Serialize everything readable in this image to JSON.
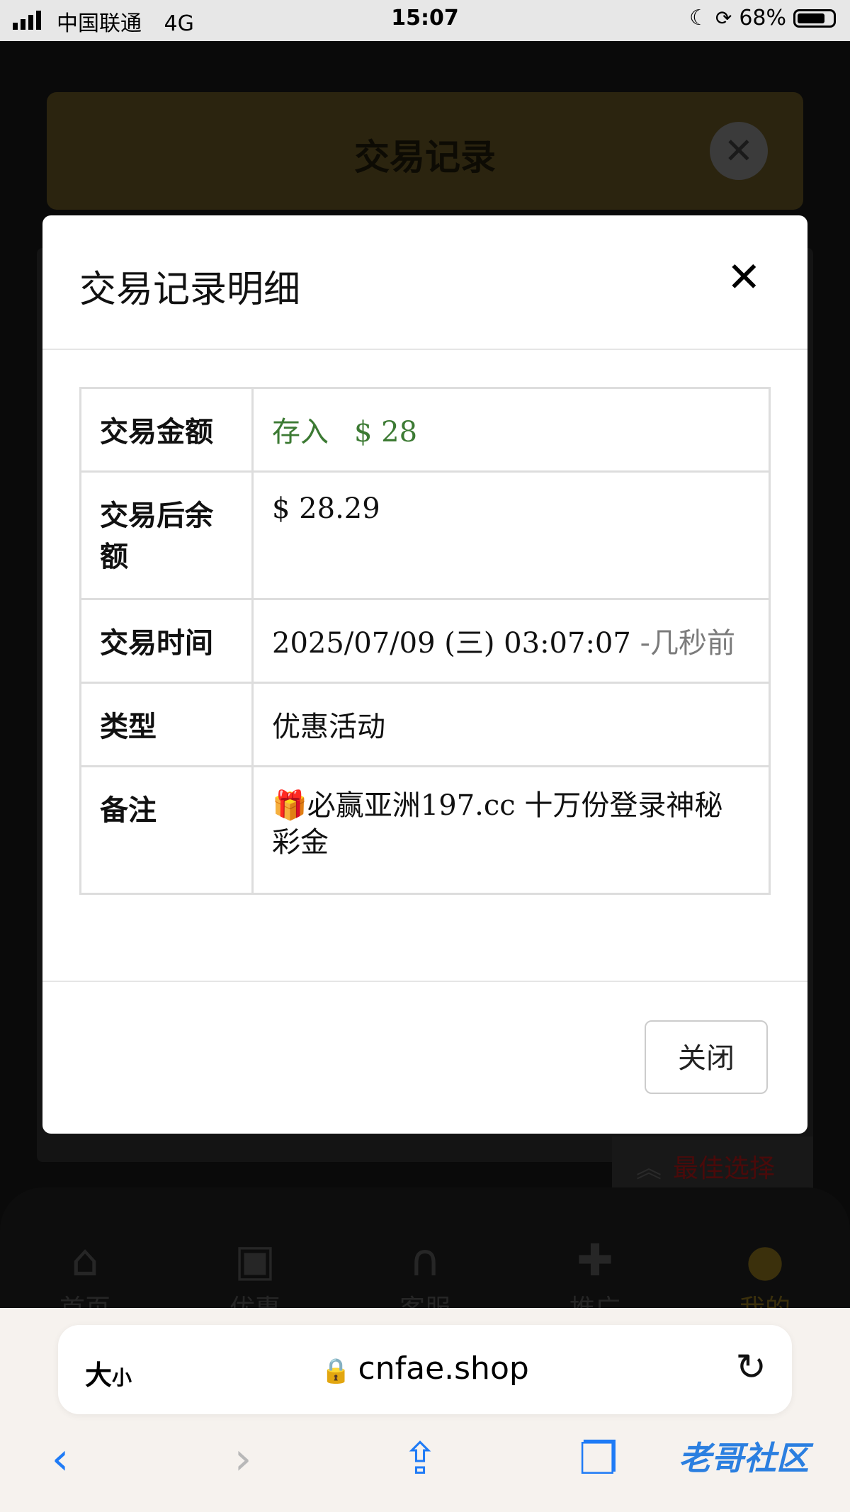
{
  "status_bar": {
    "carrier": "中国联通",
    "network": "4G",
    "time": "15:07",
    "battery": "68%"
  },
  "background_page": {
    "header_title": "交易记录",
    "best_choice_label": "最佳选择",
    "nav": [
      {
        "label": "首页",
        "icon": "home-icon"
      },
      {
        "label": "优惠",
        "icon": "gift-icon"
      },
      {
        "label": "客服",
        "icon": "headphones-icon"
      },
      {
        "label": "推广",
        "icon": "add-user-icon"
      },
      {
        "label": "我的",
        "icon": "user-icon"
      }
    ]
  },
  "modal": {
    "title": "交易记录明细",
    "rows": [
      {
        "label": "交易金额",
        "value_type": "存入",
        "value_amount": "$ 28"
      },
      {
        "label": "交易后余额",
        "value": "$ 28.29"
      },
      {
        "label": "交易时间",
        "value": "2025/07/09 (三) 03:07:07",
        "value_suffix": " -几秒前"
      },
      {
        "label": "类型",
        "value": "优惠活动"
      },
      {
        "label": "备注",
        "value": "🎁必赢亚洲197.cc 十万份登录神秘彩金"
      }
    ],
    "close_button_label": "关闭"
  },
  "browser": {
    "text_size_big": "大",
    "text_size_small": "小",
    "url": "cnfae.shop",
    "watermark": "老哥社区"
  },
  "colors": {
    "deposit_green": "#3c7a33",
    "link_blue": "#1f7bf6"
  }
}
